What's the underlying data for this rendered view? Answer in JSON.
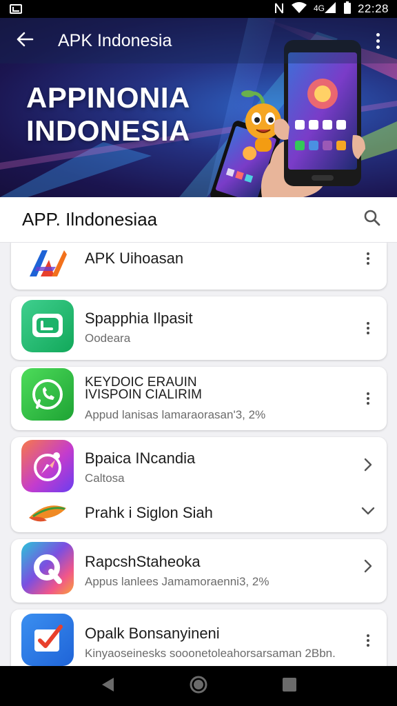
{
  "status_bar": {
    "time": "22:28",
    "icons": [
      "photo-icon",
      "nfc-icon",
      "wifi-icon",
      "signal-icon",
      "battery-icon"
    ]
  },
  "header": {
    "back_icon": "arrow-left-icon",
    "title": "APK Indonesia",
    "menu_icon": "more-vert-icon"
  },
  "hero": {
    "line1": "APPINONIA",
    "line2": "INDONESIA"
  },
  "section": {
    "title": "APP. Ilndonesiaa",
    "search_icon": "search-icon"
  },
  "apps": [
    {
      "name": "APK Uihoasan",
      "action": "more-vert-icon"
    },
    {
      "name": "Spapphia Ilpasit",
      "sub": "Oodeara",
      "action": "more-vert-icon"
    },
    {
      "name_top": "KEYDOIC ERAUIN",
      "name": "IVISPOIN CIALIRIM",
      "sub": "Appud lanisas lamaraorasan'3, 2%",
      "action": "more-vert-icon"
    },
    {
      "name": "Bpaica INcandia",
      "sub": "Caltosa",
      "action": "chevron-right-icon"
    },
    {
      "name": "Prahk i Siglon Siah",
      "action": "chevron-down-icon"
    },
    {
      "name": "RapcshStaheoka",
      "sub": "Appus lanlees Jamamoraenni3, 2%",
      "action": "chevron-right-icon"
    },
    {
      "name": "Opalk Bonsanyineni",
      "sub": "Kinyaoseinesks sooonetoleahorsarsaman 2Bbn.",
      "action": "more-vert-icon"
    }
  ],
  "nav_bar": {
    "back": "nav-back-icon",
    "home": "nav-home-icon",
    "recents": "nav-recents-icon"
  },
  "colors": {
    "hero_dark": "#1b1550",
    "hero_blue": "#2e63c4",
    "card_bg": "#ffffff",
    "page_bg": "#f1f1f4",
    "whatsapp_green": "#2db742"
  }
}
